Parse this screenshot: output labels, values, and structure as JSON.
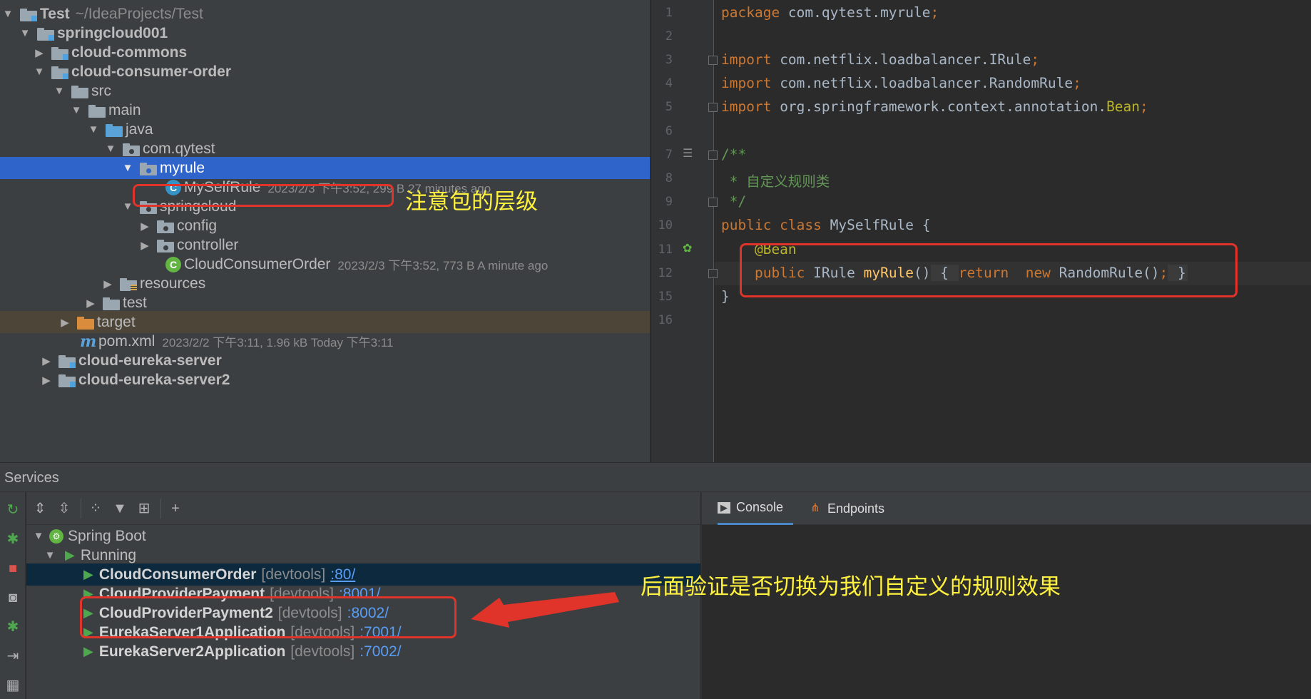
{
  "project_tree": {
    "root": {
      "name": "Test",
      "path": "~/IdeaProjects/Test"
    },
    "items": [
      {
        "name": "springcloud001"
      },
      {
        "name": "cloud-commons"
      },
      {
        "name": "cloud-consumer-order"
      },
      {
        "name": "src"
      },
      {
        "name": "main"
      },
      {
        "name": "java"
      },
      {
        "name": "com.qytest"
      },
      {
        "name": "myrule"
      },
      {
        "name": "MySelfRule",
        "meta": "2023/2/3 下午3:52, 299 B 27 minutes ago",
        "icon_letter": "C"
      },
      {
        "name": "springcloud"
      },
      {
        "name": "config"
      },
      {
        "name": "controller"
      },
      {
        "name": "CloudConsumerOrder",
        "meta": "2023/2/3 下午3:52, 773 B A minute ago",
        "icon_letter": "C"
      },
      {
        "name": "resources"
      },
      {
        "name": "test"
      },
      {
        "name": "target"
      },
      {
        "name": "pom.xml",
        "meta": "2023/2/2 下午3:11, 1.96 kB Today 下午3:11",
        "icon_letter": "m"
      },
      {
        "name": "cloud-eureka-server"
      },
      {
        "name": "cloud-eureka-server2"
      }
    ]
  },
  "editor": {
    "line_numbers": [
      "1",
      "2",
      "3",
      "4",
      "5",
      "6",
      "7",
      "8",
      "9",
      "10",
      "11",
      "12",
      "15",
      "16"
    ],
    "code": {
      "l1_kw": "package",
      "l1_rest": " com.qytest.myrule",
      "l1_semi": ";",
      "l3_kw": "import",
      "l3_rest": " com.netflix.loadbalancer.IRule",
      "l3_semi": ";",
      "l4_kw": "import",
      "l4_rest": " com.netflix.loadbalancer.RandomRule",
      "l4_semi": ";",
      "l5_kw": "import",
      "l5_rest": " org.springframework.context.annotation.",
      "l5_ann": "Bean",
      "l5_semi": ";",
      "l7": "/**",
      "l8": " * 自定义规则类",
      "l9": " */",
      "l10_kw": "public class",
      "l10_rest": " MySelfRule {",
      "l11": "    @Bean",
      "l12_kw": "    public",
      "l12_type": " IRule ",
      "l12_fn": "myRule",
      "l12_paren": "()",
      "l12_open": " { ",
      "l12_ret": "return",
      "l12_new": "  new",
      "l12_ctor": " RandomRule()",
      "l12_semi": ";",
      "l12_close": " }",
      "l15": "}"
    }
  },
  "services": {
    "title": "Services",
    "tree": {
      "group": "Spring Boot",
      "state": "Running",
      "apps": [
        {
          "name": "CloudConsumerOrder",
          "tag": "[devtools]",
          "port": ":80/"
        },
        {
          "name": "CloudProviderPayment",
          "tag": "[devtools]",
          "port": ":8001/"
        },
        {
          "name": "CloudProviderPayment2",
          "tag": "[devtools]",
          "port": ":8002/"
        },
        {
          "name": "EurekaServer1Application",
          "tag": "[devtools]",
          "port": ":7001/"
        },
        {
          "name": "EurekaServer2Application",
          "tag": "[devtools]",
          "port": ":7002/"
        }
      ]
    },
    "tabs": {
      "console": "Console",
      "endpoints": "Endpoints"
    }
  },
  "annotations": {
    "package_note": "注意包的层级",
    "verify_note": "后面验证是否切换为我们自定义的规则效果"
  },
  "colors": {
    "highlight_red": "#e0342a",
    "annotation_yellow": "#fff23e",
    "selection_blue": "#2f65ca"
  }
}
